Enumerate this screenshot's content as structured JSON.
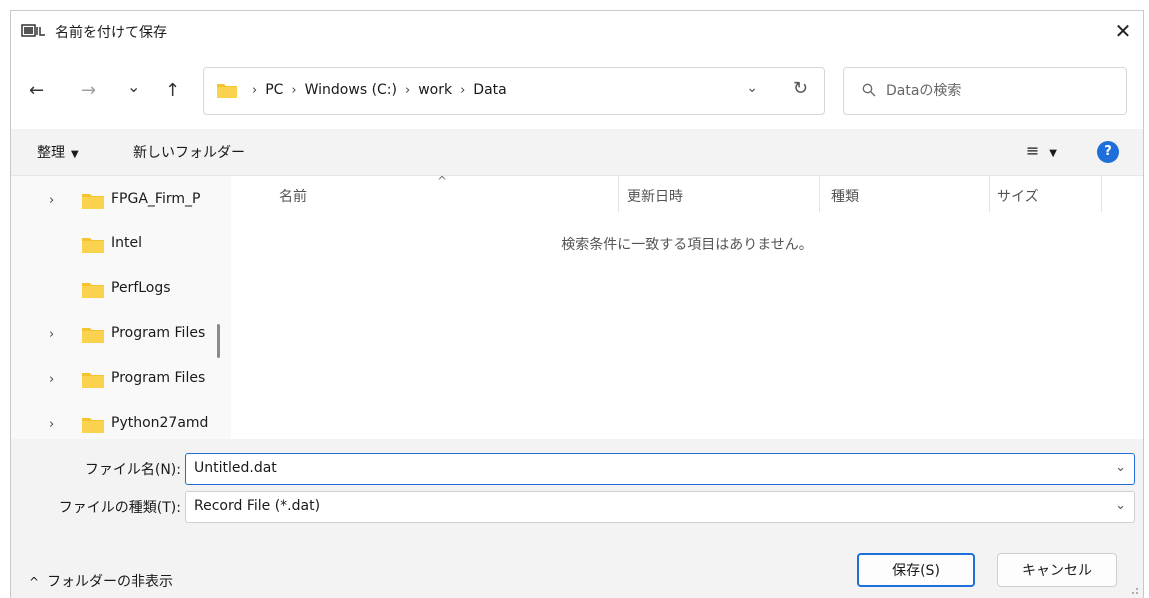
{
  "window": {
    "title": "名前を付けて保存",
    "close_glyph": "✕"
  },
  "nav": {
    "back": "←",
    "forward": "→",
    "recent": "⌄",
    "up": "↑",
    "breadcrumb": [
      "PC",
      "Windows (C:)",
      "work",
      "Data"
    ],
    "separator": "›",
    "dropdown_glyph": "⌄",
    "refresh_glyph": "↻"
  },
  "search": {
    "placeholder": "Dataの検索"
  },
  "toolbar": {
    "organize_label": "整理",
    "new_folder_label": "新しいフォルダー",
    "view_glyph": "≡",
    "dropdown_glyph": "▼",
    "help_glyph": "?"
  },
  "sidebar": {
    "items": [
      {
        "label": "FPGA_Firm_P",
        "expandable": true
      },
      {
        "label": "Intel",
        "expandable": false
      },
      {
        "label": "PerfLogs",
        "expandable": false
      },
      {
        "label": "Program Files",
        "expandable": true
      },
      {
        "label": "Program Files",
        "expandable": true
      },
      {
        "label": "Python27amd",
        "expandable": true
      }
    ],
    "chevron_glyph": "›"
  },
  "filelist": {
    "columns": [
      "名前",
      "更新日時",
      "種類",
      "サイズ"
    ],
    "sort_caret": "^",
    "empty_message": "検索条件に一致する項目はありません。"
  },
  "form": {
    "filename_label": "ファイル名(N):",
    "filename_value": "Untitled.dat",
    "filetype_label": "ファイルの種類(T):",
    "filetype_value": "Record File (*.dat)",
    "dropdown_glyph": "⌄"
  },
  "footer": {
    "hide_folders_label": "フォルダーの非表示",
    "hide_folders_glyph": "^",
    "save_label": "保存(S)",
    "cancel_label": "キャンセル"
  },
  "colors": {
    "accent": "#1e6fd9",
    "folder": "#f4c430",
    "background": "#f3f3f3"
  }
}
